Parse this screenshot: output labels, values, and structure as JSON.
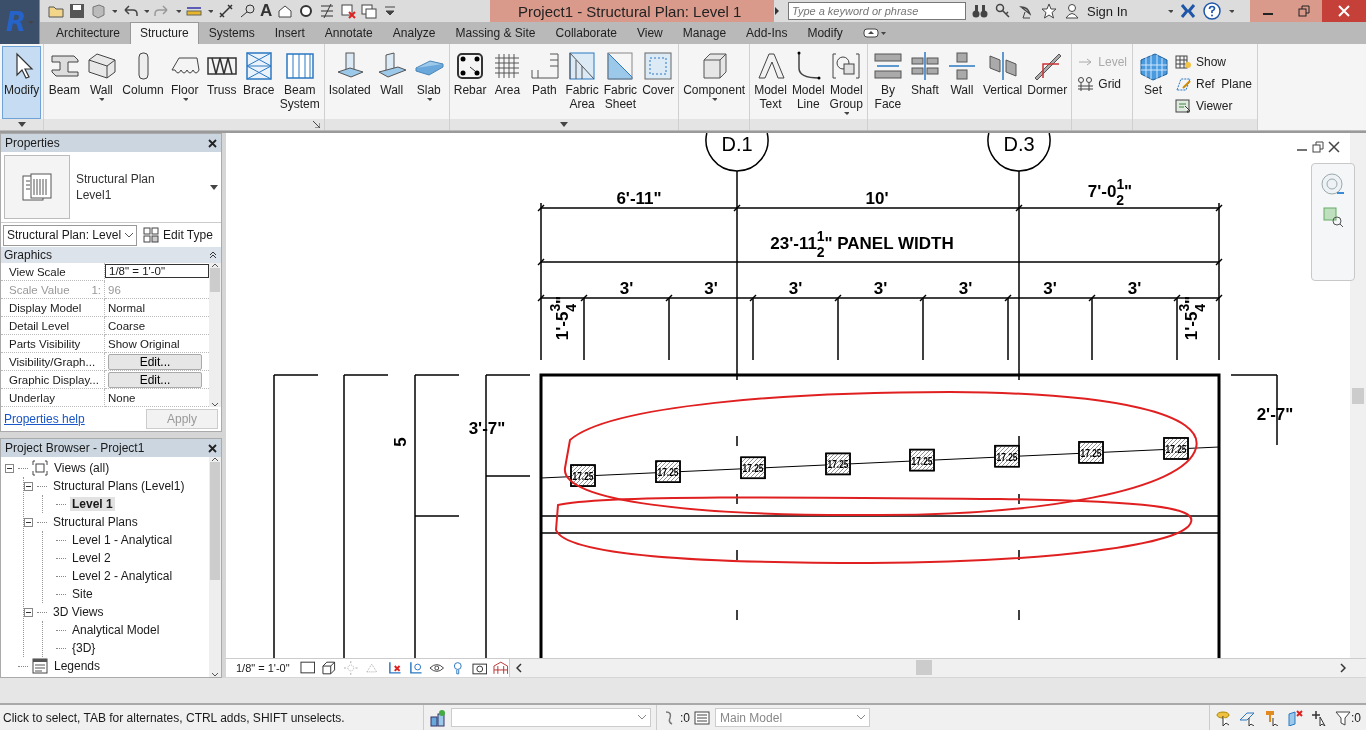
{
  "app_button": {
    "letter": "R"
  },
  "quick_access": {
    "text_tool": "A"
  },
  "title": "Project1 - Structural Plan: Level 1",
  "search": {
    "placeholder": "Type a keyword or phrase"
  },
  "sign_in": "Sign In",
  "tabs": [
    {
      "label": "Architecture",
      "selected": false
    },
    {
      "label": "Structure",
      "selected": true
    },
    {
      "label": "Systems",
      "selected": false
    },
    {
      "label": "Insert",
      "selected": false
    },
    {
      "label": "Annotate",
      "selected": false
    },
    {
      "label": "Analyze",
      "selected": false
    },
    {
      "label": "Massing & Site",
      "selected": false
    },
    {
      "label": "Collaborate",
      "selected": false
    },
    {
      "label": "View",
      "selected": false
    },
    {
      "label": "Manage",
      "selected": false
    },
    {
      "label": "Add-Ins",
      "selected": false
    },
    {
      "label": "Modify",
      "selected": false
    }
  ],
  "ribbon": {
    "groups": [
      {
        "items": [
          {
            "kind": "modify",
            "label": "Modify",
            "selected": true,
            "dropdown": false
          }
        ]
      },
      {
        "items": [
          {
            "kind": "beam",
            "label": "Beam",
            "selected": false,
            "dropdown": false
          },
          {
            "kind": "wall",
            "label": "Wall",
            "selected": false,
            "dropdown": true
          },
          {
            "kind": "column",
            "label": "Column",
            "selected": false,
            "dropdown": false
          },
          {
            "kind": "floor",
            "label": "Floor",
            "selected": false,
            "dropdown": true
          },
          {
            "kind": "truss",
            "label": "Truss",
            "selected": false,
            "dropdown": false
          },
          {
            "kind": "brace",
            "label": "Brace",
            "selected": false,
            "dropdown": false
          },
          {
            "kind": "beamsystem",
            "label": "Beam System",
            "selected": false,
            "dropdown": false
          }
        ]
      },
      {
        "items": [
          {
            "kind": "isolated",
            "label": "Isolated",
            "selected": false,
            "dropdown": false
          },
          {
            "kind": "footing",
            "label": "Wall",
            "selected": false,
            "dropdown": false
          },
          {
            "kind": "slab",
            "label": "Slab",
            "selected": false,
            "dropdown": true
          }
        ]
      },
      {
        "items": [
          {
            "kind": "rebar",
            "label": "Rebar",
            "selected": false,
            "dropdown": false
          },
          {
            "kind": "area",
            "label": "Area",
            "selected": false,
            "dropdown": false
          },
          {
            "kind": "path",
            "label": "Path",
            "selected": false,
            "dropdown": false
          },
          {
            "kind": "fabricarea",
            "label": "Fabric Area",
            "selected": false,
            "dropdown": false
          },
          {
            "kind": "fabricsheet",
            "label": "Fabric Sheet",
            "selected": false,
            "dropdown": false
          },
          {
            "kind": "cover",
            "label": "Cover",
            "selected": false,
            "dropdown": false
          }
        ]
      },
      {
        "items": [
          {
            "kind": "component",
            "label": "Component",
            "selected": false,
            "dropdown": true
          }
        ]
      },
      {
        "items": [
          {
            "kind": "modeltext",
            "label": "Model Text",
            "selected": false,
            "dropdown": false
          },
          {
            "kind": "modelline",
            "label": "Model Line",
            "selected": false,
            "dropdown": false
          },
          {
            "kind": "modelgroup",
            "label": "Model Group",
            "selected": false,
            "dropdown": true
          }
        ]
      },
      {
        "items": [
          {
            "kind": "byface",
            "label": "By Face",
            "selected": false,
            "dropdown": false
          },
          {
            "kind": "shaft",
            "label": "Shaft",
            "selected": false,
            "dropdown": false
          },
          {
            "kind": "openwall",
            "label": "Wall",
            "selected": false,
            "dropdown": false
          },
          {
            "kind": "vertical",
            "label": "Vertical",
            "selected": false,
            "dropdown": false
          },
          {
            "kind": "dormer",
            "label": "Dormer",
            "selected": false,
            "dropdown": false
          }
        ]
      },
      {
        "stack": [
          {
            "kind": "level",
            "label": "Level",
            "disabled": true
          },
          {
            "kind": "grid",
            "label": "Grid",
            "disabled": false
          }
        ]
      },
      {
        "items": [
          {
            "kind": "set",
            "label": "Set",
            "selected": false,
            "dropdown": false
          }
        ],
        "stack": [
          {
            "kind": "show",
            "label": "Show",
            "disabled": false
          },
          {
            "kind": "refplane",
            "label": "Ref  Plane",
            "disabled": false
          },
          {
            "kind": "viewer",
            "label": "Viewer",
            "disabled": false
          }
        ]
      }
    ]
  },
  "properties": {
    "title": "Properties",
    "type_line1": "Structural Plan",
    "type_line2": "Level1",
    "instance_selector": "Structural Plan: Level",
    "edit_type": "Edit Type",
    "section": "Graphics",
    "rows": [
      {
        "kind": "input",
        "name": "View Scale",
        "value": "1/8\" = 1'-0\"",
        "disabled": false
      },
      {
        "kind": "text",
        "name": "Scale Value",
        "suffix": "1:",
        "value": "96",
        "disabled": true
      },
      {
        "kind": "text",
        "name": "Display Model",
        "value": "Normal",
        "disabled": false
      },
      {
        "kind": "text",
        "name": "Detail Level",
        "value": "Coarse",
        "disabled": false
      },
      {
        "kind": "text",
        "name": "Parts Visibility",
        "value": "Show Original",
        "disabled": false
      },
      {
        "kind": "button",
        "name": "Visibility/Graph...",
        "value": "Edit...",
        "disabled": false
      },
      {
        "kind": "button",
        "name": "Graphic Display...",
        "value": "Edit...",
        "disabled": false
      },
      {
        "kind": "text",
        "name": "Underlay",
        "value": "None",
        "disabled": false
      }
    ],
    "help_link": "Properties help",
    "apply": {
      "label": "Apply",
      "disabled": true
    }
  },
  "project_browser": {
    "title": "Project Browser - Project1",
    "tree": [
      {
        "label": "Views (all)",
        "kind": "views",
        "expanded": true,
        "selected": false,
        "children": [
          {
            "label": "Structural Plans (Level1)",
            "expanded": true,
            "selected": false,
            "children": [
              {
                "label": "Level 1",
                "selected": true
              }
            ]
          },
          {
            "label": "Structural Plans",
            "expanded": true,
            "selected": false,
            "children": [
              {
                "label": "Level 1 - Analytical",
                "selected": false
              },
              {
                "label": "Level 2",
                "selected": false
              },
              {
                "label": "Level 2 - Analytical",
                "selected": false
              },
              {
                "label": "Site",
                "selected": false
              }
            ]
          },
          {
            "label": "3D Views",
            "expanded": true,
            "selected": false,
            "children": [
              {
                "label": "Analytical Model",
                "selected": false
              },
              {
                "label": "{3D}",
                "selected": false
              }
            ]
          }
        ]
      },
      {
        "label": "Legends",
        "kind": "legends",
        "selected": false
      }
    ]
  },
  "drawing": {
    "grid_heads": [
      "D.1",
      "D.3"
    ],
    "top_dims": [
      {
        "text": "6'-11\""
      },
      {
        "text": "10'"
      },
      {
        "text": "7'-0",
        "num": "1",
        "den": "2",
        "suffix": "\""
      }
    ],
    "overall_dim": {
      "text": "23'-11",
      "num": "1",
      "den": "2",
      "suffix": "\" PANEL WIDTH"
    },
    "spacing_dims": [
      "3'",
      "3'",
      "3'",
      "3'",
      "3'",
      "3'",
      "3'"
    ],
    "end_dims": [
      {
        "text": "1'-5",
        "num": "3",
        "den": "4",
        "suffix": "\""
      },
      {
        "text": "1'-5",
        "num": "3",
        "den": "4",
        "suffix": "\""
      }
    ],
    "left_dims": [
      "5",
      "3'-7\""
    ],
    "right_dim": "2'-7\"",
    "tags": [
      "17.25",
      "17.25",
      "17.25",
      "17.25",
      "17.25",
      "17.25",
      "17.25",
      "17.25"
    ]
  },
  "view_control_bar": {
    "scale": "1/8\" = 1'-0\""
  },
  "status_bar": {
    "message": "Click to select, TAB for alternates, CTRL adds, SHIFT unselects.",
    "workset_count": ":0",
    "model": "Main Model",
    "filter_count": ":0"
  }
}
